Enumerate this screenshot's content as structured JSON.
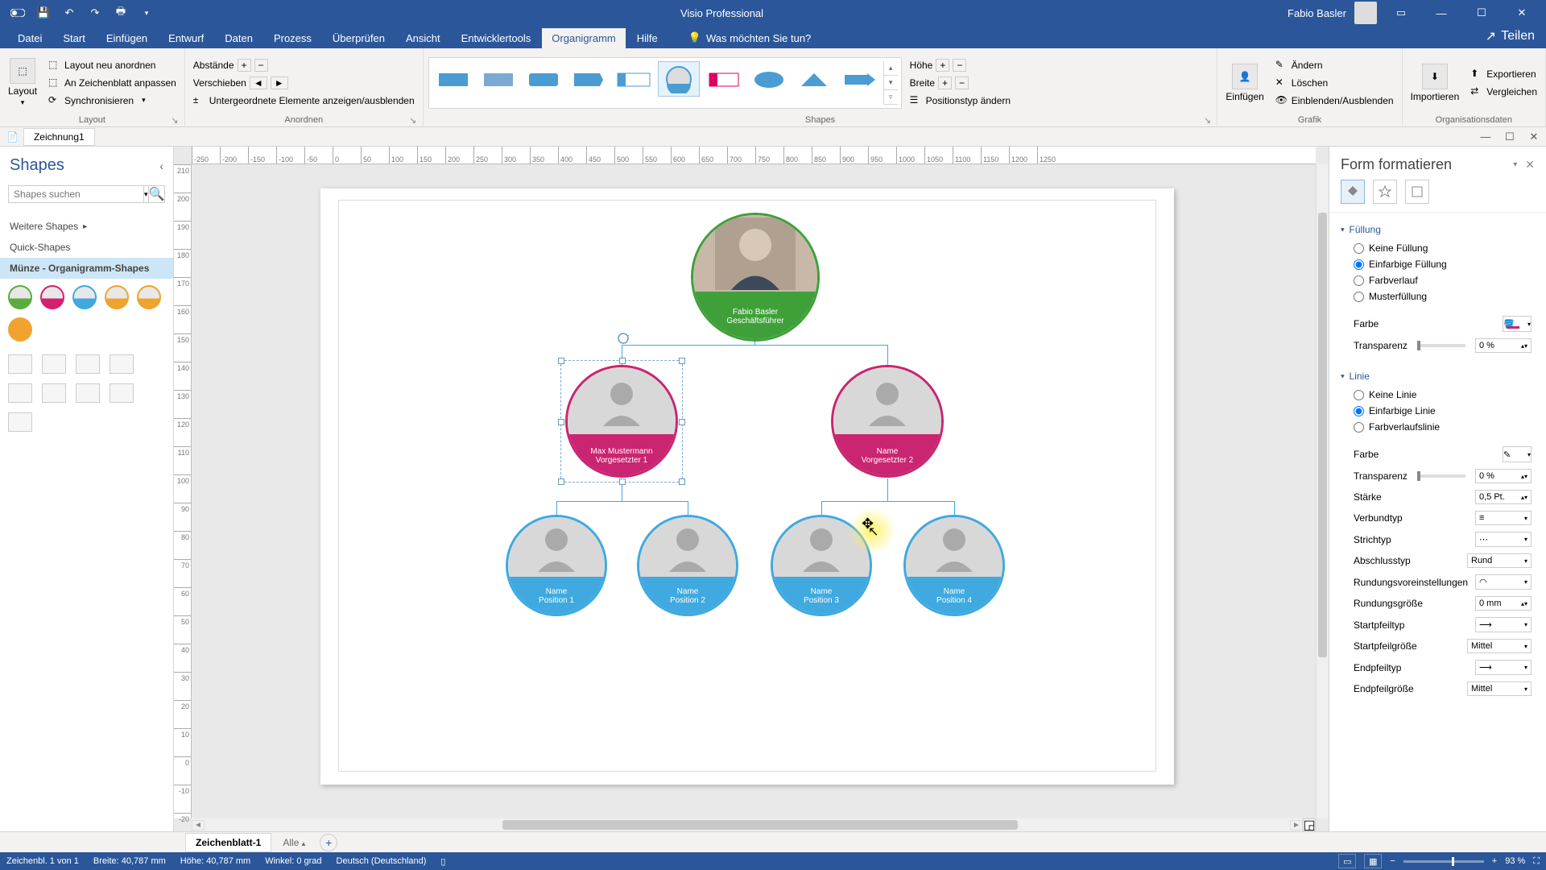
{
  "app": {
    "title": "Visio Professional",
    "user": "Fabio Basler",
    "share": "Teilen"
  },
  "qat": {
    "save": "💾"
  },
  "tabs": [
    "Datei",
    "Start",
    "Einfügen",
    "Entwurf",
    "Daten",
    "Prozess",
    "Überprüfen",
    "Ansicht",
    "Entwicklertools",
    "Organigramm",
    "Hilfe"
  ],
  "active_tab": "Organigramm",
  "tell_me": "Was möchten Sie tun?",
  "ribbon": {
    "layout": {
      "big": "Layout",
      "group": "Layout",
      "items": [
        "Layout neu anordnen",
        "An Zeichenblatt anpassen",
        "Synchronisieren"
      ]
    },
    "arrange": {
      "group": "Anordnen",
      "dist": "Abstände",
      "move": "Verschieben",
      "subs": "Untergeordnete Elemente anzeigen/ausblenden"
    },
    "shapes": {
      "group": "Shapes",
      "h": "Höhe",
      "w": "Breite",
      "pos": "Positionstyp ändern"
    },
    "picture": {
      "group": "Grafik",
      "ins": "Einfügen",
      "chg": "Ändern",
      "del": "Löschen",
      "toggle": "Einblenden/Ausblenden"
    },
    "orgdata": {
      "group": "Organisationsdaten",
      "imp": "Importieren",
      "exp": "Exportieren",
      "cmp": "Vergleichen"
    }
  },
  "doc_tab": "Zeichnung1",
  "shapes_panel": {
    "title": "Shapes",
    "search_placeholder": "Shapes suchen",
    "more": "Weitere Shapes",
    "quick": "Quick-Shapes",
    "stencil": "Münze - Organigramm-Shapes"
  },
  "org": {
    "ceo": {
      "name": "Fabio Basler",
      "role": "Geschäftsführer"
    },
    "mgr1": {
      "name": "Max Mustermann",
      "role": "Vorgesetzter 1"
    },
    "mgr2": {
      "name": "Name",
      "role": "Vorgesetzter 2"
    },
    "emp1": {
      "name": "Name",
      "role": "Position 1"
    },
    "emp2": {
      "name": "Name",
      "role": "Position 2"
    },
    "emp3": {
      "name": "Name",
      "role": "Position 3"
    },
    "emp4": {
      "name": "Name",
      "role": "Position 4"
    }
  },
  "format": {
    "title": "Form formatieren",
    "fill": {
      "title": "Füllung",
      "none": "Keine Füllung",
      "solid": "Einfarbige Füllung",
      "grad": "Farbverlauf",
      "pattern": "Musterfüllung"
    },
    "color": "Farbe",
    "transp": "Transparenz",
    "transp_val": "0 %",
    "line": {
      "title": "Linie",
      "none": "Keine Linie",
      "solid": "Einfarbige Linie",
      "grad": "Farbverlaufslinie"
    },
    "line_transp_val": "0 %",
    "width": "Stärke",
    "width_val": "0,5 Pt.",
    "compound": "Verbundtyp",
    "dash": "Strichtyp",
    "cap": "Abschlusstyp",
    "cap_val": "Rund",
    "round": "Rundungsvoreinstellungen",
    "roundsize": "Rundungsgröße",
    "roundsize_val": "0 mm",
    "begarr": "Startpfeiltyp",
    "begsize": "Startpfeilgröße",
    "begsize_val": "Mittel",
    "endarr": "Endpfeiltyp",
    "endsize": "Endpfeilgröße",
    "endsize_val": "Mittel"
  },
  "pagetabs": {
    "sheet": "Zeichenblatt-1",
    "all": "Alle"
  },
  "status": {
    "s1": "Zeichenbl. 1 von 1",
    "s2": "Breite: 40,787 mm",
    "s3": "Höhe: 40,787 mm",
    "s4": "Winkel: 0 grad",
    "lang": "Deutsch (Deutschland)",
    "zoom": "93 %"
  },
  "ruler_h": [
    "-250",
    "-200",
    "-150",
    "-100",
    "-50",
    "0",
    "50",
    "100",
    "150",
    "200",
    "250",
    "300",
    "350",
    "400",
    "450",
    "500",
    "550",
    "600",
    "650",
    "700",
    "750",
    "800",
    "850",
    "900",
    "950",
    "1000",
    "1050",
    "1100",
    "1150",
    "1200",
    "1250"
  ],
  "ruler_v": [
    "210",
    "200",
    "190",
    "180",
    "170",
    "160",
    "150",
    "140",
    "130",
    "120",
    "110",
    "100",
    "90",
    "80",
    "70",
    "60",
    "50",
    "40",
    "30",
    "20",
    "10",
    "0",
    "-10",
    "-20"
  ]
}
